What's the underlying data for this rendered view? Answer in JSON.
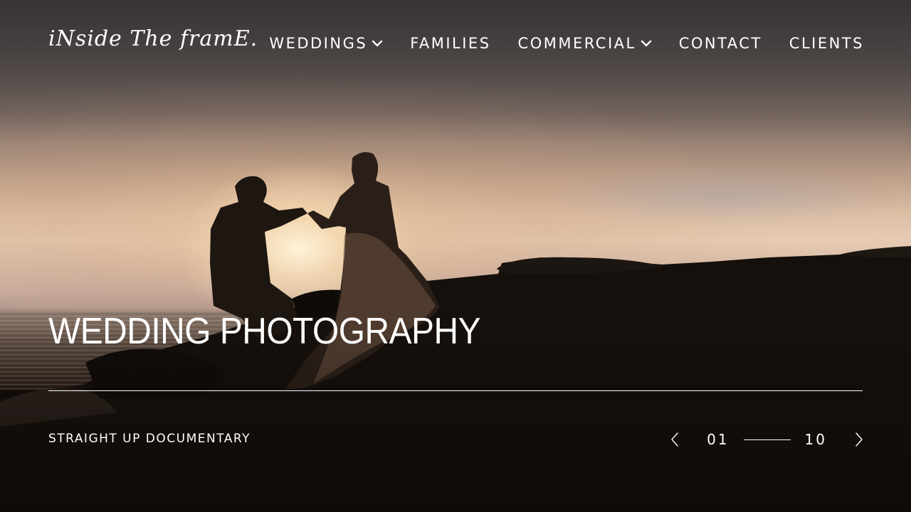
{
  "brand": {
    "logo_text": "iNside The framE."
  },
  "nav": {
    "items": [
      {
        "label": "WEDDINGS",
        "has_dropdown": true
      },
      {
        "label": "FAMILIES",
        "has_dropdown": false
      },
      {
        "label": "COMMERCIAL",
        "has_dropdown": true
      },
      {
        "label": "CONTACT",
        "has_dropdown": false
      },
      {
        "label": "CLIENTS",
        "has_dropdown": false
      }
    ]
  },
  "hero": {
    "title": "WEDDING PHOTOGRAPHY",
    "tagline": "STRAIGHT UP DOCUMENTARY"
  },
  "slider": {
    "current": "01",
    "total": "10",
    "prev_icon": "chevron-left-icon",
    "next_icon": "chevron-right-icon"
  },
  "colors": {
    "text": "#ffffff",
    "overlay": "#0b0806"
  }
}
